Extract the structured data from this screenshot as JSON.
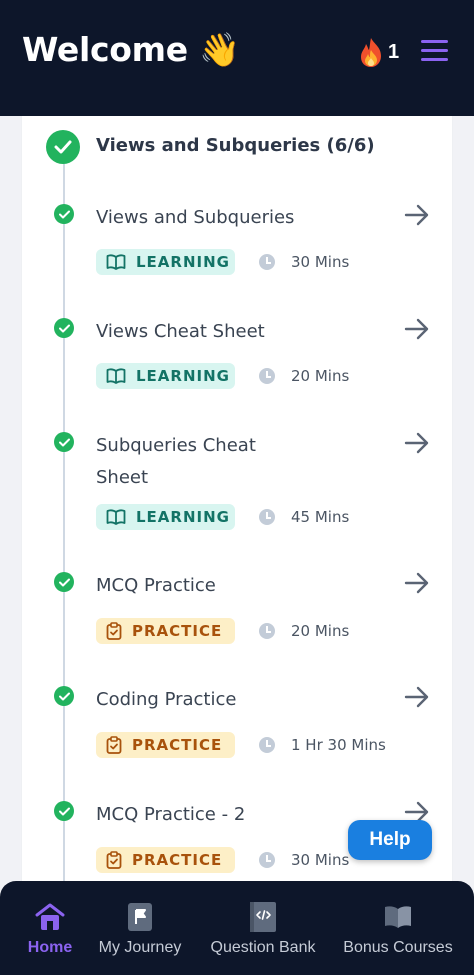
{
  "header": {
    "welcome": "Welcome",
    "wave_emoji": "👋",
    "streak_icon": "fire-icon",
    "streak_count": "1",
    "menu_icon": "hamburger-menu-icon"
  },
  "section": {
    "title": "Views and Subqueries (6/6)"
  },
  "items": [
    {
      "title": "Views and Subqueries",
      "tag": "LEARNING",
      "tag_type": "learning",
      "duration": "30 Mins"
    },
    {
      "title": "Views Cheat Sheet",
      "tag": "LEARNING",
      "tag_type": "learning",
      "duration": "20 Mins"
    },
    {
      "title": "Subqueries Cheat Sheet",
      "tag": "LEARNING",
      "tag_type": "learning",
      "duration": "45 Mins"
    },
    {
      "title": "MCQ Practice",
      "tag": "PRACTICE",
      "tag_type": "practice",
      "duration": "20 Mins"
    },
    {
      "title": "Coding Practice",
      "tag": "PRACTICE",
      "tag_type": "practice",
      "duration": "1 Hr 30 Mins"
    },
    {
      "title": "MCQ Practice - 2",
      "tag": "PRACTICE",
      "tag_type": "practice",
      "duration": "30 Mins"
    }
  ],
  "help": {
    "label": "Help"
  },
  "nav": [
    {
      "label": "Home",
      "icon": "home-icon",
      "active": true
    },
    {
      "label": "My Journey",
      "icon": "flag-icon",
      "active": false
    },
    {
      "label": "Question Bank",
      "icon": "code-book-icon",
      "active": false
    },
    {
      "label": "Bonus Courses",
      "icon": "open-book-icon",
      "active": false
    }
  ],
  "colors": {
    "header_bg": "#0d162a",
    "accent": "#8b63f0",
    "success": "#22b35e",
    "learning_bg": "#d8f5f0",
    "practice_bg": "#fdefc7",
    "help_bg": "#1a7fe0"
  }
}
